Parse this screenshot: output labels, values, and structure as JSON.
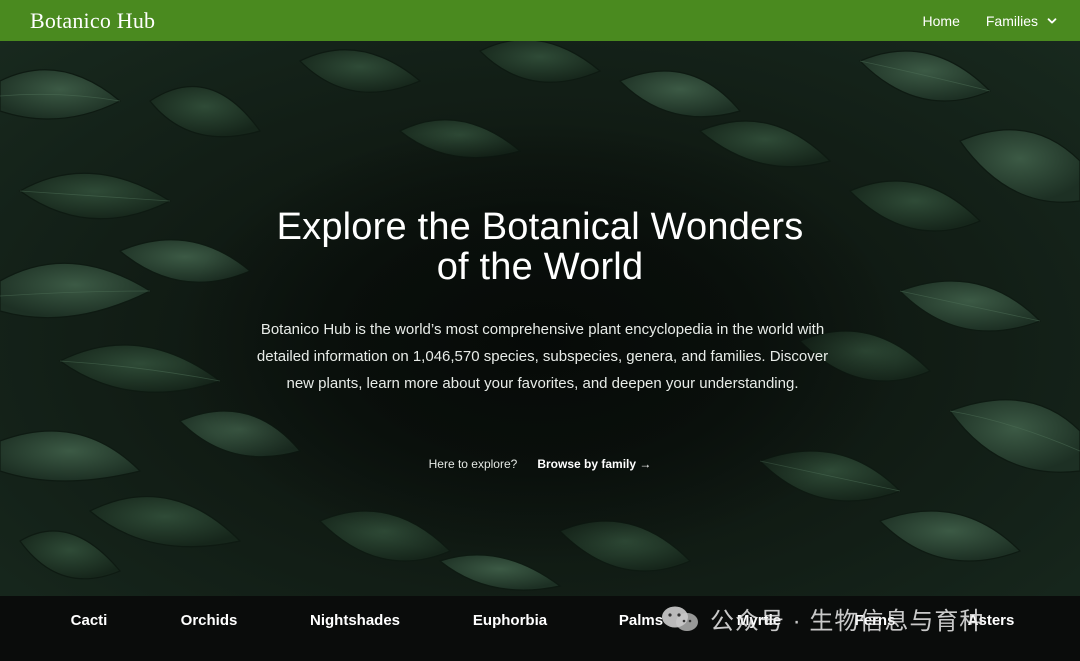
{
  "navbar": {
    "brand": "Botanico Hub",
    "links": [
      {
        "label": "Home"
      },
      {
        "label": "Families"
      }
    ],
    "color": "#4a8a1f"
  },
  "hero": {
    "title_line1": "Explore the Botanical Wonders",
    "title_line2": "of the World",
    "description": "Botanico Hub is the world’s most comprehensive plant encyclopedia in the world with detailed information on 1,046,570 species, subspecies, genera, and families. Discover new plants, learn more about your favorites, and deepen your understanding.",
    "explore_question": "Here to explore?",
    "explore_link": "Browse by family →"
  },
  "families": [
    {
      "label": "Cacti"
    },
    {
      "label": "Orchids"
    },
    {
      "label": "Nightshades"
    },
    {
      "label": "Euphorbia"
    },
    {
      "label": "Palms"
    },
    {
      "label": "Myrtle"
    },
    {
      "label": "Ferns"
    },
    {
      "label": "Asters"
    }
  ],
  "watermark": {
    "text": "公众号 · 生物信息与育种"
  }
}
